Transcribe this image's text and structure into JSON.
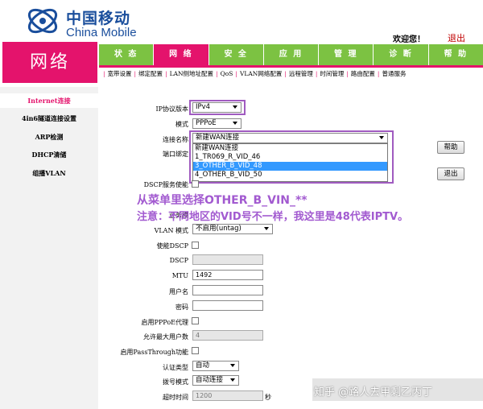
{
  "brand": {
    "name_cn": "中国移动",
    "name_en": "China Mobile"
  },
  "header": {
    "welcome": "欢迎您！",
    "logout": "退出"
  },
  "page_title": "网络",
  "nav": {
    "tabs": [
      {
        "label": "状 态"
      },
      {
        "label": "网 络"
      },
      {
        "label": "安 全"
      },
      {
        "label": "应 用"
      },
      {
        "label": "管 理"
      },
      {
        "label": "诊 断"
      },
      {
        "label": "帮 助"
      }
    ]
  },
  "subnav": {
    "items": [
      "宽带设置",
      "绑定配置",
      "LAN侧地址配置",
      "QoS",
      "VLAN网络配置",
      "远程管理",
      "时间管理",
      "路由配置",
      "普通服务"
    ]
  },
  "sidebar": {
    "items": [
      {
        "label": "Internet连接"
      },
      {
        "label": "4in6隧道连接设置"
      },
      {
        "label": "ARP检测"
      },
      {
        "label": "DHCP清储"
      },
      {
        "label": "组播VLAN"
      }
    ]
  },
  "form": {
    "ip_version": {
      "label": "IP协议版本",
      "value": "IPv4"
    },
    "mode": {
      "label": "模式",
      "value": "PPPoE"
    },
    "conn_name": {
      "label": "连接名称",
      "value": "新建WAN连接"
    },
    "port_bind": {
      "label": "端口绑定"
    },
    "dscp_service": {
      "label": "DSCP服务使能"
    },
    "service_mode": {
      "label": "业务模"
    },
    "vlan_mode": {
      "label": "VLAN 模式",
      "value": "不启用(untag)"
    },
    "enable_dscp": {
      "label": "使能DSCP"
    },
    "dscp": {
      "label": "DSCP",
      "value": ""
    },
    "mtu": {
      "label": "MTU",
      "value": "1492"
    },
    "username": {
      "label": "用户名",
      "value": ""
    },
    "password": {
      "label": "密码",
      "value": ""
    },
    "pppoe_proxy": {
      "label": "启用PPPoE代理"
    },
    "max_users": {
      "label": "允许最大用户数",
      "value": "4"
    },
    "passthrough": {
      "label": "启用PassThrough功能"
    },
    "auth_type": {
      "label": "认证类型",
      "value": "自动"
    },
    "dial_mode": {
      "label": "拨号模式",
      "value": "自动连接"
    },
    "timeout": {
      "label": "超时时间",
      "value": "1200",
      "unit": "秒"
    }
  },
  "dropdown_options": [
    "新建WAN连接",
    "1_TR069_R_VID_46",
    "3_OTHER_B_VID_48",
    "4_OTHER_B_VID_50"
  ],
  "dropdown_selected_index": 2,
  "buttons": {
    "help": "帮助",
    "exit": "退出"
  },
  "annotation": {
    "line1": "从菜单里选择OTHER_B_VIN_**",
    "line2": "注意：不同地区的VID号不一样，我这里是48代表IPTV。"
  },
  "watermark": "知乎 @路人去甲剩乙丙丁",
  "colors": {
    "accent_pink": "#e4136c",
    "nav_green": "#7cc242",
    "brand_blue": "#1a4e9c",
    "annotation_purple": "#a25ad0",
    "highlight": "#3399ff"
  }
}
